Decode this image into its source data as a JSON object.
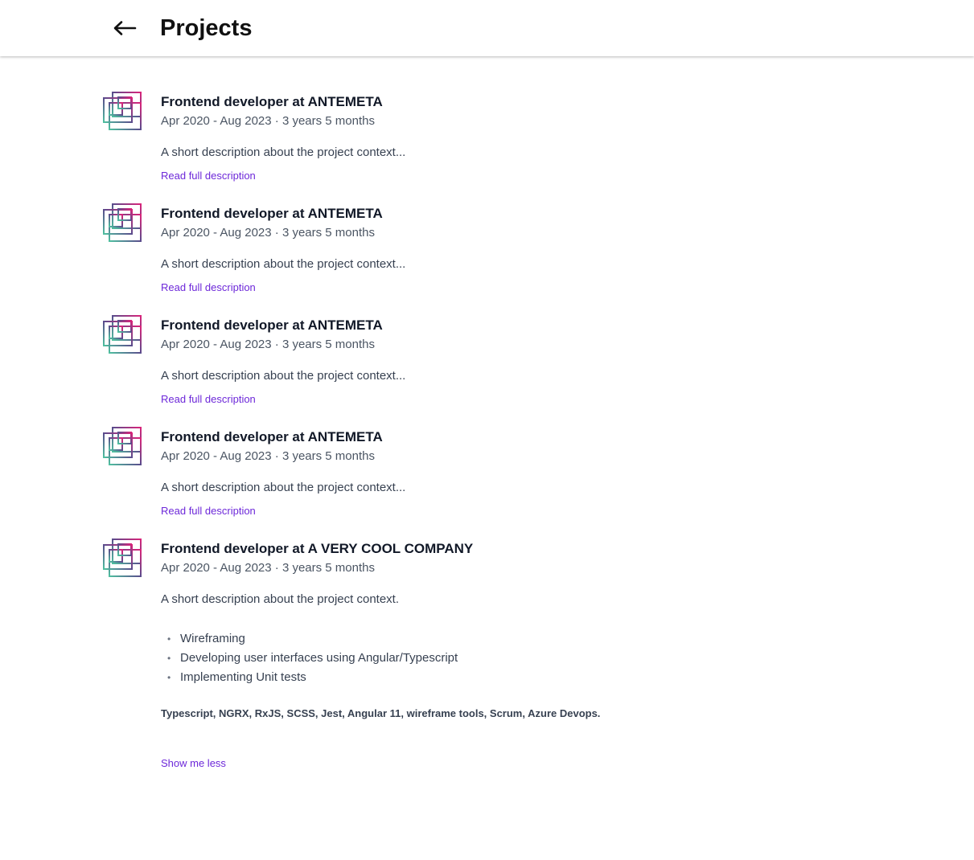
{
  "header": {
    "title": "Projects",
    "back_icon": "arrow-left-icon"
  },
  "colors": {
    "accent_link": "#6d28d9",
    "logo_gradient_start": "#d9247a",
    "logo_gradient_end": "#4fbf9f"
  },
  "projects": [
    {
      "title": "Frontend developer at ANTEMETA",
      "dates": "Apr 2020 - Aug 2023 · 3 years 5 months",
      "description": "A short description about the project context...",
      "link_label": "Read full description",
      "logo_icon": "company-logo-icon"
    },
    {
      "title": "Frontend developer at ANTEMETA",
      "dates": "Apr 2020 - Aug 2023 · 3 years 5 months",
      "description": "A short description about the project context...",
      "link_label": "Read full description",
      "logo_icon": "company-logo-icon"
    },
    {
      "title": "Frontend developer at ANTEMETA",
      "dates": "Apr 2020 - Aug 2023 · 3 years 5 months",
      "description": "A short description about the project context...",
      "link_label": "Read full description",
      "logo_icon": "company-logo-icon"
    },
    {
      "title": "Frontend developer at ANTEMETA",
      "dates": "Apr 2020 - Aug 2023 · 3 years 5 months",
      "description": "A short description about the project context...",
      "link_label": "Read full description",
      "logo_icon": "company-logo-icon"
    },
    {
      "title": "Frontend developer at A VERY COOL COMPANY",
      "dates": "Apr 2020 - Aug 2023 · 3 years 5 months",
      "description": "A short description about the project context.",
      "bullets": [
        "Wireframing",
        "Developing user interfaces using Angular/Typescript",
        "Implementing Unit tests"
      ],
      "technologies": "Typescript, NGRX, RxJS, SCSS, Jest, Angular 11, wireframe tools, Scrum, Azure Devops.",
      "link_label": "Show me less",
      "logo_icon": "company-logo-icon"
    }
  ]
}
